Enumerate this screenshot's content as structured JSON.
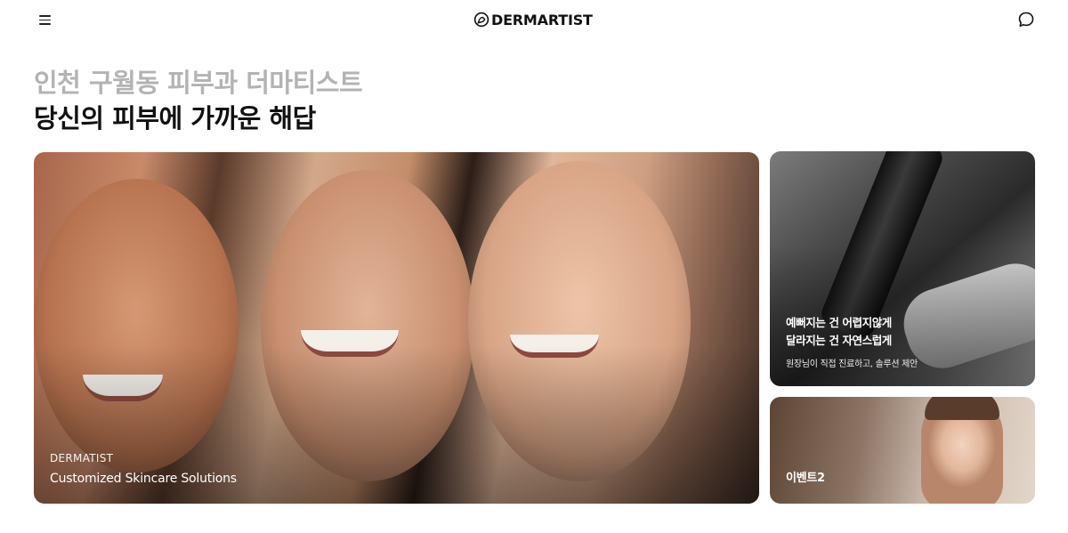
{
  "header": {
    "menu_icon": "hamburger-menu-icon",
    "brand": "DERMARTIST",
    "chat_icon": "chat-bubble-icon"
  },
  "headline": {
    "subtitle": "인천 구월동 피부과 더마티스트",
    "title": "당신의 피부에 가까운 해답"
  },
  "hero": {
    "brand": "DERMATIST",
    "title": "Customized Skincare Solutions"
  },
  "side_cards": [
    {
      "line1": "예뻐지는 건 어렵지않게",
      "line2": "달라지는 건 자연스럽게",
      "line3": "원장님이 직접 진료하고, 솔루션 제안"
    },
    {
      "label": "이벤트2"
    }
  ],
  "colors": {
    "headline_sub": "#b3b3b3",
    "headline_main": "#111111",
    "caption": "#ffffff"
  }
}
